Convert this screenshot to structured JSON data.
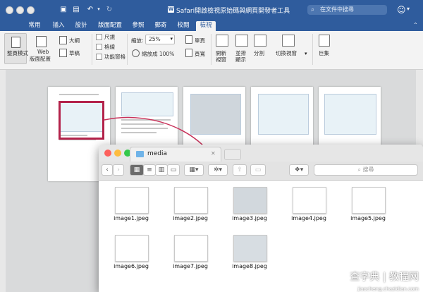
{
  "word": {
    "title": "Safari開啟檢視原始碼與網頁開發者工具",
    "search_placeholder": "在文件中搜尋",
    "tabs": [
      "常用",
      "插入",
      "設計",
      "版面配置",
      "參照",
      "郵寄",
      "校閱",
      "檢視"
    ],
    "active_tab": "檢視",
    "ribbon": {
      "print_layout": "整頁模式",
      "web_layout_1": "Web",
      "web_layout_2": "版面配置",
      "outline": "大綱",
      "draft": "草稿",
      "ruler": "尺規",
      "gridlines": "格線",
      "nav_pane": "功能窗格",
      "zoom_label": "縮放:",
      "zoom_value": "25%",
      "zoom_100": "縮放成 100%",
      "one_page": "單頁",
      "page_width": "頁寬",
      "new_window_1": "開新",
      "new_window_2": "視窗",
      "arrange_1": "並排",
      "arrange_2": "顯示",
      "split": "分割",
      "switch_windows": "切換視窗",
      "macros": "巨集"
    }
  },
  "finder": {
    "folder": "media",
    "search_placeholder": "搜尋",
    "files": [
      "image1.jpeg",
      "image2.jpeg",
      "image3.jpeg",
      "image4.jpeg",
      "image5.jpeg",
      "image6.jpeg",
      "image7.jpeg",
      "image8.jpeg"
    ]
  },
  "watermark": {
    "text": "查字典 | 教程网",
    "url": "jiaocheng.chazidian.com"
  },
  "colors": {
    "title_bar": "#2f5c9d",
    "highlight": "#b3224a"
  }
}
